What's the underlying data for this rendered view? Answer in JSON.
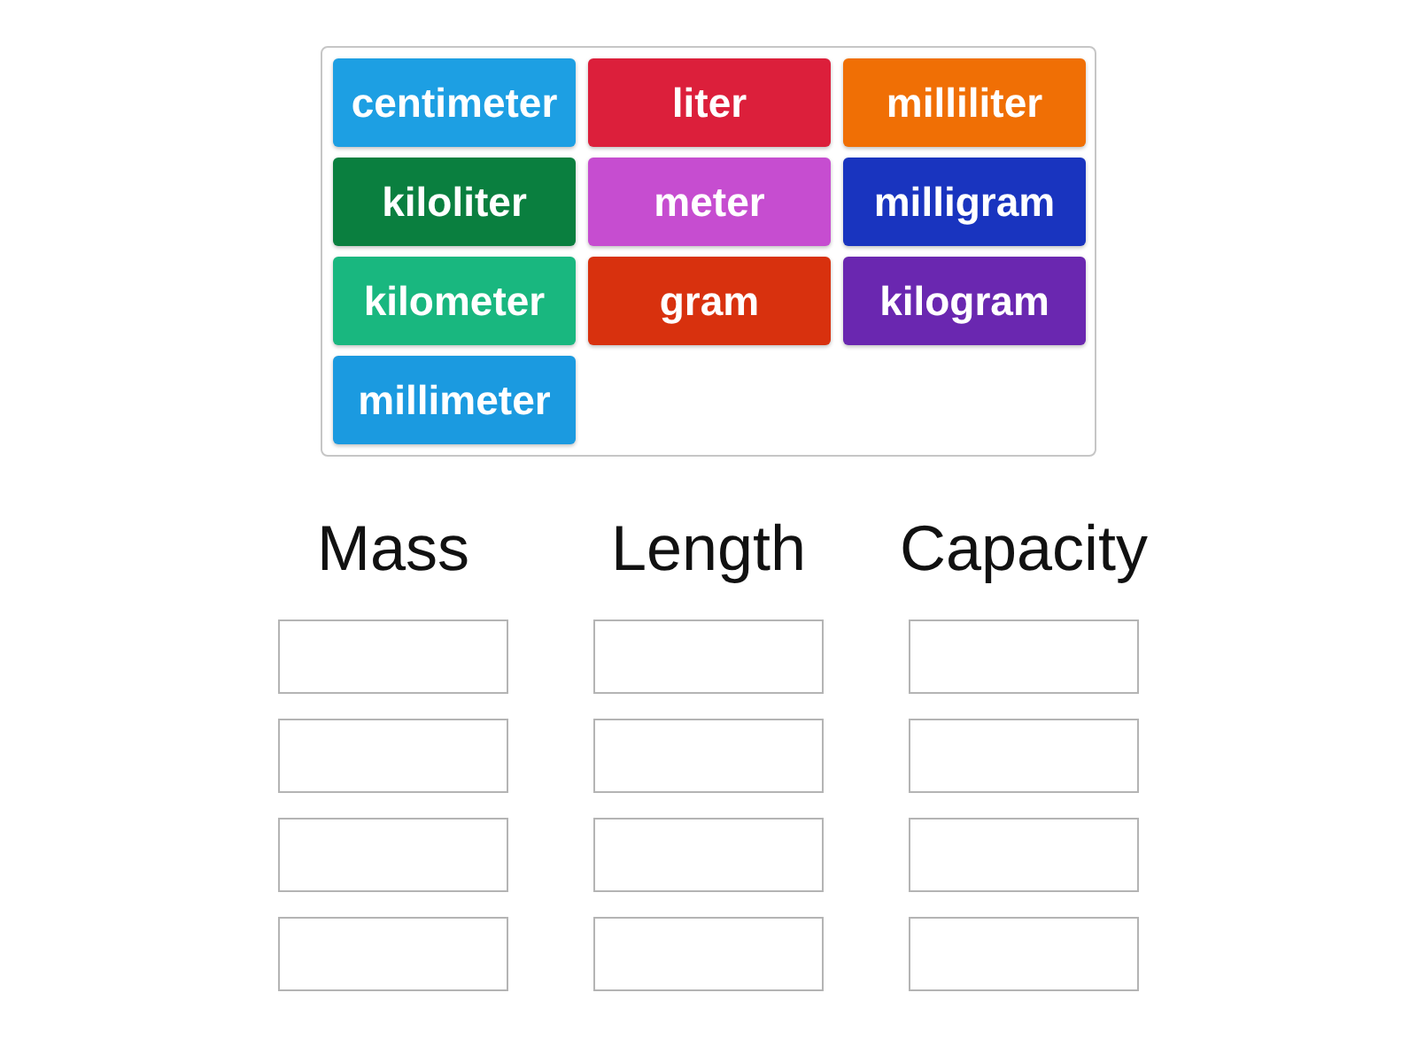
{
  "tiles": [
    {
      "label": "centimeter",
      "color": "#1d9fe3"
    },
    {
      "label": "liter",
      "color": "#dc1f3b"
    },
    {
      "label": "milliliter",
      "color": "#f06f05"
    },
    {
      "label": "kiloliter",
      "color": "#0a7f3f"
    },
    {
      "label": "meter",
      "color": "#c64dd0"
    },
    {
      "label": "milligram",
      "color": "#1934bf"
    },
    {
      "label": "kilometer",
      "color": "#19b77f"
    },
    {
      "label": "gram",
      "color": "#d8310e"
    },
    {
      "label": "kilogram",
      "color": "#6a27b0"
    },
    {
      "label": "millimeter",
      "color": "#1b9ae0"
    }
  ],
  "groups": [
    {
      "heading": "Mass",
      "slots": [
        {
          "filled": false
        },
        {
          "filled": false
        },
        {
          "filled": false
        },
        {
          "filled": false
        }
      ]
    },
    {
      "heading": "Length",
      "slots": [
        {
          "filled": false
        },
        {
          "filled": false
        },
        {
          "filled": false
        },
        {
          "filled": false
        }
      ]
    },
    {
      "heading": "Capacity",
      "slots": [
        {
          "filled": false
        },
        {
          "filled": false
        },
        {
          "filled": false
        },
        {
          "filled": false
        }
      ]
    }
  ]
}
